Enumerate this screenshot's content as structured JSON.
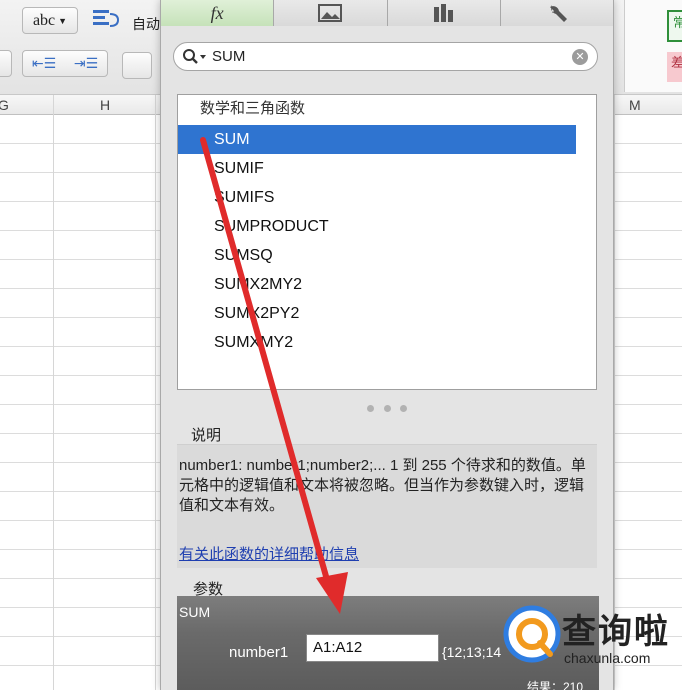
{
  "ribbon": {
    "abc_label": "abc",
    "auto_label": "自动",
    "style_green_text": "常",
    "style_pink_text": "差"
  },
  "columns": {
    "g": "G",
    "h": "H",
    "m": "M"
  },
  "tabs": [
    {
      "label": "fx",
      "icon": "fx-icon"
    },
    {
      "label": "",
      "icon": "image-icon"
    },
    {
      "label": "",
      "icon": "column-chart-icon"
    },
    {
      "label": "",
      "icon": "wrench-icon"
    }
  ],
  "search": {
    "value": "SUM",
    "icon": "search-icon",
    "clear_icon": "clear-icon"
  },
  "function_list": {
    "category": "数学和三角函数",
    "items": [
      "SUM",
      "SUMIF",
      "SUMIFS",
      "SUMPRODUCT",
      "SUMSQ",
      "SUMX2MY2",
      "SUMX2PY2",
      "SUMXMY2"
    ],
    "selected": "SUM"
  },
  "description": {
    "label": "说明",
    "text": "number1: number1;number2;... 1 到 255 个待求和的数值。单元格中的逻辑值和文本将被忽略。但当作为参数键入时，逻辑值和文本有效。",
    "help_link": "有关此函数的详细帮助信息"
  },
  "arguments": {
    "label": "参数",
    "function_name": "SUM",
    "arg_name": "number1",
    "arg_value": "A1:A12",
    "arg_result": "{12;13;14",
    "total_result": "结果：210"
  },
  "watermark": {
    "text": "查询啦",
    "url": "chaxunla.com"
  },
  "colors": {
    "selection": "#2f74d0",
    "arrow": "#e02b2b",
    "active_tab": "#c6e2b9",
    "link": "#1f3fb0"
  }
}
